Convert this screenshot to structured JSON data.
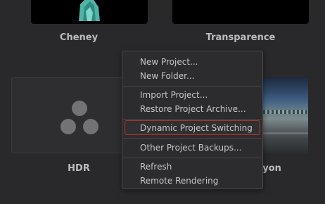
{
  "projects": [
    {
      "name": "Cheney"
    },
    {
      "name": "Transparence"
    },
    {
      "name": "HDR"
    },
    {
      "name": "uyon"
    }
  ],
  "context_menu": {
    "items": [
      "New Project...",
      "New Folder...",
      "Import Project...",
      "Restore Project Archive...",
      "Dynamic Project Switching",
      "Other Project Backups...",
      "Refresh",
      "Remote Rendering"
    ],
    "highlighted_index": 4
  },
  "colors": {
    "background": "#29292b",
    "menu_background": "#2c2c2e",
    "highlight_border": "#b5342c",
    "text": "#c7c7c7"
  }
}
